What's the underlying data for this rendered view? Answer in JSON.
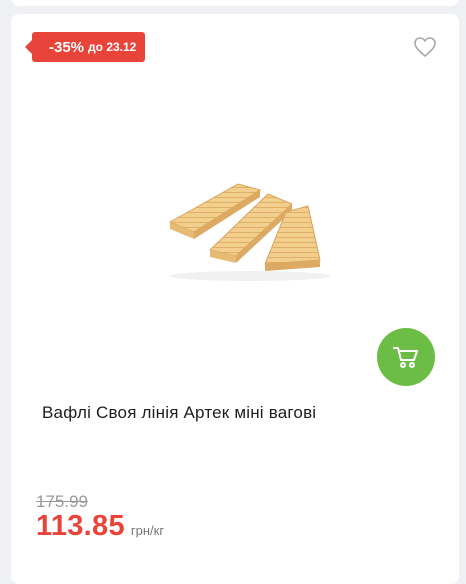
{
  "product": {
    "discount_label": "-35%",
    "discount_until": "до 23.12",
    "title": "Вафлі Своя лінія Артек міні вагові",
    "old_price": "175.99",
    "price": "113.85",
    "unit": "грн/кг",
    "image_icon": "wafer-product-image",
    "favorite_icon": "heart-icon",
    "cart_icon": "cart-icon"
  },
  "colors": {
    "discount_badge": "#e8443a",
    "price": "#e8443a",
    "cart_button": "#6cbd45",
    "background": "#eef0f3"
  }
}
